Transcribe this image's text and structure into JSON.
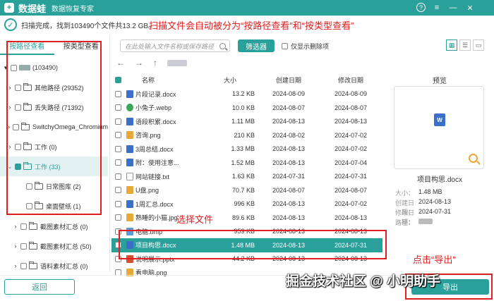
{
  "app": {
    "logo_glyph": "+",
    "name": "数据蛙",
    "subtitle": "数据恢复专家",
    "help": "?"
  },
  "status": {
    "text": "扫描完成，找到103490个文件共13.2 GB。"
  },
  "annotations": {
    "top": "扫描文件会自动被分为“按路径查看”和“按类型查看”",
    "select": "选择文件",
    "export": "点击“导出”"
  },
  "tabs": [
    {
      "label": "按路径查看"
    },
    {
      "label": "按类型查看"
    }
  ],
  "tree": [
    {
      "label": "(103490)"
    },
    {
      "label": "其他路径 (29352)"
    },
    {
      "label": "丢失路径 (71392)"
    },
    {
      "label": "SwitchyOmega_Chromium"
    },
    {
      "label": "工作 (0)"
    },
    {
      "label": "工作 (33)"
    },
    {
      "label": "日常图库 (2)"
    },
    {
      "label": "桌面壁纸 (1)"
    },
    {
      "label": "截图素材汇总 (0)"
    },
    {
      "label": "截图素材汇总 (50)"
    },
    {
      "label": "语料素材汇总 (0)"
    }
  ],
  "toolbar": {
    "search_placeholder": "在此处输入文件名称或保存路径",
    "filter": "筛选器",
    "deleted_only": "仅显示删除项"
  },
  "nav": {
    "back": "←",
    "forward": "→",
    "up": "↑"
  },
  "table": {
    "headers": {
      "name": "名称",
      "size": "大小",
      "created": "创建日期",
      "modified": "修改日期"
    },
    "rows": [
      {
        "name": "片段记录.docx",
        "size": "13.2 KB",
        "created": "2024-08-09",
        "modified": "2024-08-09",
        "icon": "doc"
      },
      {
        "name": "小兔子.webp",
        "size": "10.0 KB",
        "created": "2024-08-07",
        "modified": "2024-08-07",
        "icon": "webp"
      },
      {
        "name": "语段积累.docx",
        "size": "1.11 MB",
        "created": "2024-08-13",
        "modified": "2024-08-13",
        "icon": "doc"
      },
      {
        "name": "咨询.png",
        "size": "210 KB",
        "created": "2024-08-02",
        "modified": "2024-07-02",
        "icon": "img"
      },
      {
        "name": "3周总结.docx",
        "size": "1.33 MB",
        "created": "2024-08-13",
        "modified": "2024-07-02",
        "icon": "doc"
      },
      {
        "name": "附：使用注意...",
        "size": "1.52 MB",
        "created": "2024-08-13",
        "modified": "2024-07-04",
        "icon": "doc"
      },
      {
        "name": "网站链接.txt",
        "size": "1.63 KB",
        "created": "2024-07-31",
        "modified": "2024-07-31",
        "icon": "txt"
      },
      {
        "name": "U盘.png",
        "size": "70.7 KB",
        "created": "2024-08-07",
        "modified": "2024-08-07",
        "icon": "img"
      },
      {
        "name": "1周汇总.docx",
        "size": "996 KB",
        "created": "2024-08-13",
        "modified": "2024-07-02",
        "icon": "doc"
      },
      {
        "name": "熟睡的小猫.jpg",
        "size": "89.6 KB",
        "created": "2024-08-13",
        "modified": "2024-08-13",
        "icon": "img"
      },
      {
        "name": "电脑.bmp",
        "size": "959 KB",
        "created": "2024-08-13",
        "modified": "2024-08-13",
        "icon": "bmp"
      },
      {
        "name": "项目构思.docx",
        "size": "1.48 MB",
        "created": "2024-08-13",
        "modified": "2024-07-31",
        "icon": "doc"
      },
      {
        "name": "说明展示.pptx",
        "size": "44.2 KB",
        "created": "2024-08-13",
        "modified": "2024-08-13",
        "icon": "ppt"
      },
      {
        "name": "看电脑.png",
        "size": "",
        "created": "",
        "modified": "",
        "icon": "img"
      }
    ]
  },
  "preview": {
    "title": "预览",
    "doc_glyph": "W",
    "filename": "项目构思.docx",
    "size_label": "大小：",
    "size": "1.48 MB",
    "created_label": "创建日期：",
    "created": "2024-08-13",
    "modified_label": "修改日期：",
    "modified": "2024-07-31",
    "path_label": "路径："
  },
  "buttons": {
    "back": "返回",
    "export": "导出"
  },
  "watermark": "掘金技术社区 @ 小明助手"
}
